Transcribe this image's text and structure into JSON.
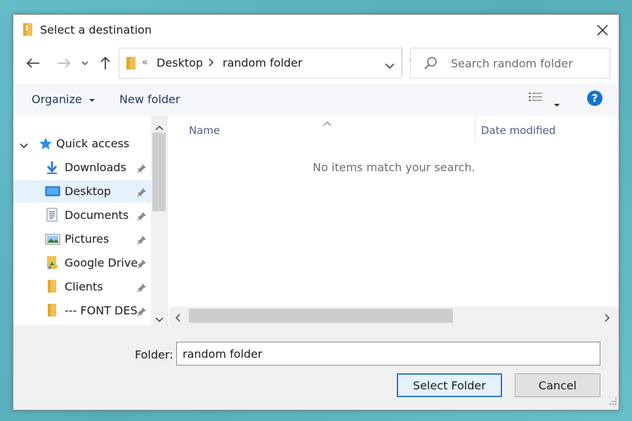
{
  "window": {
    "title": "Select a destination"
  },
  "address_bar": {
    "overflow": "«",
    "crumbs": [
      "Desktop",
      "random folder"
    ]
  },
  "search": {
    "placeholder": "Search random folder"
  },
  "command_bar": {
    "organize_label": "Organize",
    "new_folder_label": "New folder",
    "help_label": "?"
  },
  "nav_pane": {
    "quick_access_label": "Quick access",
    "items": [
      {
        "label": "Downloads",
        "icon": "downloads-icon",
        "pinned": true
      },
      {
        "label": "Desktop",
        "icon": "desktop-icon",
        "pinned": true,
        "selected": true
      },
      {
        "label": "Documents",
        "icon": "documents-icon",
        "pinned": true
      },
      {
        "label": "Pictures",
        "icon": "pictures-icon",
        "pinned": true
      },
      {
        "label": "Google Drive",
        "icon": "google-drive-icon",
        "pinned": true
      },
      {
        "label": "Clients",
        "icon": "folder-icon",
        "pinned": true
      },
      {
        "label": "--- FONT DES",
        "icon": "folder-icon",
        "pinned": true
      }
    ]
  },
  "file_list": {
    "columns": [
      "Name",
      "Date modified"
    ],
    "empty_message": "No items match your search."
  },
  "bottom": {
    "folder_label": "Folder:",
    "folder_value": "random folder",
    "select_button": "Select Folder",
    "cancel_button": "Cancel"
  },
  "colors": {
    "background": "#5fb7c3",
    "accent": "#1a73c9",
    "selection": "#e5f1fb",
    "folder": "#f2c04f"
  }
}
